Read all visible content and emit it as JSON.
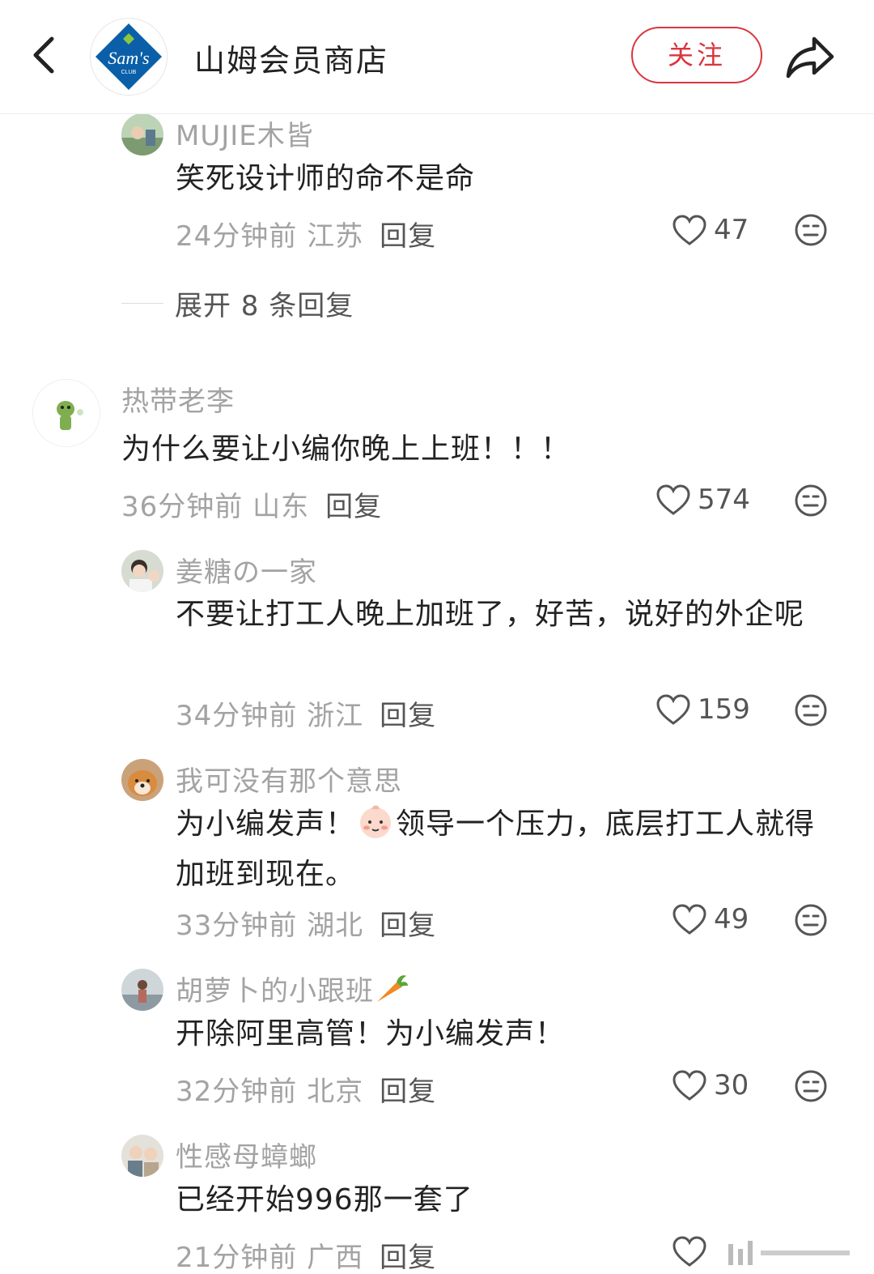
{
  "header": {
    "shop_name": "山姆会员商店",
    "follow_label": "关注",
    "logo_text": "Sam's",
    "logo_subtext": "CLUB",
    "brand_color": "#d9363e"
  },
  "comments": [
    {
      "username": "MUJIE木皆",
      "text": "笑死设计师的命不是命",
      "time": "24分钟前",
      "location": "江苏",
      "reply_label": "回复",
      "likes": "47"
    },
    {
      "username": "热带老李",
      "text": "为什么要让小编你晚上上班！！！",
      "time": "36分钟前",
      "location": "山东",
      "reply_label": "回复",
      "likes": "574"
    },
    {
      "username": "姜糖の一家",
      "text": "不要让打工人晚上加班了，好苦，说好的外企呢",
      "time": "34分钟前",
      "location": "浙江",
      "reply_label": "回复",
      "likes": "159"
    },
    {
      "username": "我可没有那个意思",
      "text_before_emoji": "为小编发声！",
      "text_after_emoji": "领导一个压力，底层打工人就得加班到现在。",
      "time": "33分钟前",
      "location": "湖北",
      "reply_label": "回复",
      "likes": "49"
    },
    {
      "username": "胡萝卜的小跟班",
      "text": "开除阿里高管！为小编发声！",
      "time": "32分钟前",
      "location": "北京",
      "reply_label": "回复",
      "likes": "30"
    },
    {
      "username": "性感母蟑螂",
      "text": "已经开始996那一套了",
      "time": "21分钟前",
      "location": "广西",
      "reply_label": "回复"
    }
  ],
  "expand_replies": "展开 8 条回复",
  "icons": {
    "back": "chevron-left-icon",
    "share": "share-arrow-icon",
    "like": "heart-icon",
    "dislike": "neutral-face-icon",
    "emoji": "baby-face-emoji",
    "carrot": "carrot-emoji"
  }
}
